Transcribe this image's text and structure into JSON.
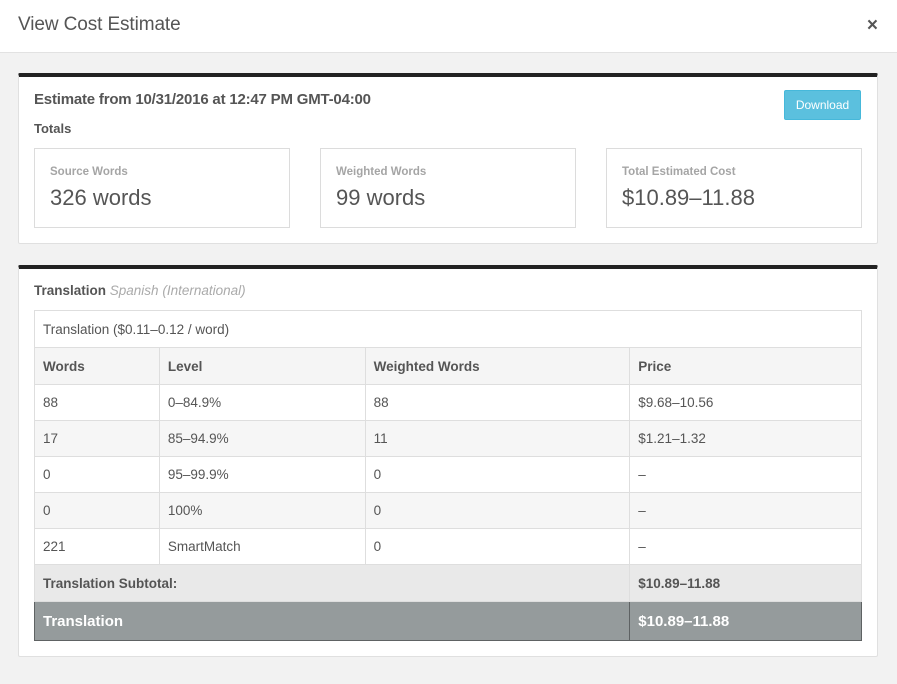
{
  "modal": {
    "title": "View Cost Estimate",
    "close_glyph": "×"
  },
  "estimate": {
    "title": "Estimate from 10/31/2016 at 12:47 PM GMT-04:00",
    "totals_label": "Totals",
    "download_label": "Download",
    "stats": [
      {
        "label": "Source Words",
        "value": "326 words"
      },
      {
        "label": "Weighted Words",
        "value": "99 words"
      },
      {
        "label": "Total Estimated Cost",
        "value": "$10.89–11.88"
      }
    ]
  },
  "translation": {
    "name": "Translation",
    "language": "Spanish (International)",
    "rate_caption": "Translation ($0.11–0.12 / word)",
    "columns": [
      "Words",
      "Level",
      "Weighted Words",
      "Price"
    ],
    "rows": [
      [
        "88",
        "0–84.9%",
        "88",
        "$9.68–10.56"
      ],
      [
        "17",
        "85–94.9%",
        "11",
        "$1.21–1.32"
      ],
      [
        "0",
        "95–99.9%",
        "0",
        "–"
      ],
      [
        "0",
        "100%",
        "0",
        "–"
      ],
      [
        "221",
        "SmartMatch",
        "0",
        "–"
      ]
    ],
    "subtotal_label": "Translation Subtotal:",
    "subtotal_value": "$10.89–11.88",
    "total_label": "Translation",
    "total_value": "$10.89–11.88"
  },
  "colors": {
    "download_button": "#5bc0de",
    "panel_top_border": "#222222",
    "total_row": "#959b9c"
  }
}
